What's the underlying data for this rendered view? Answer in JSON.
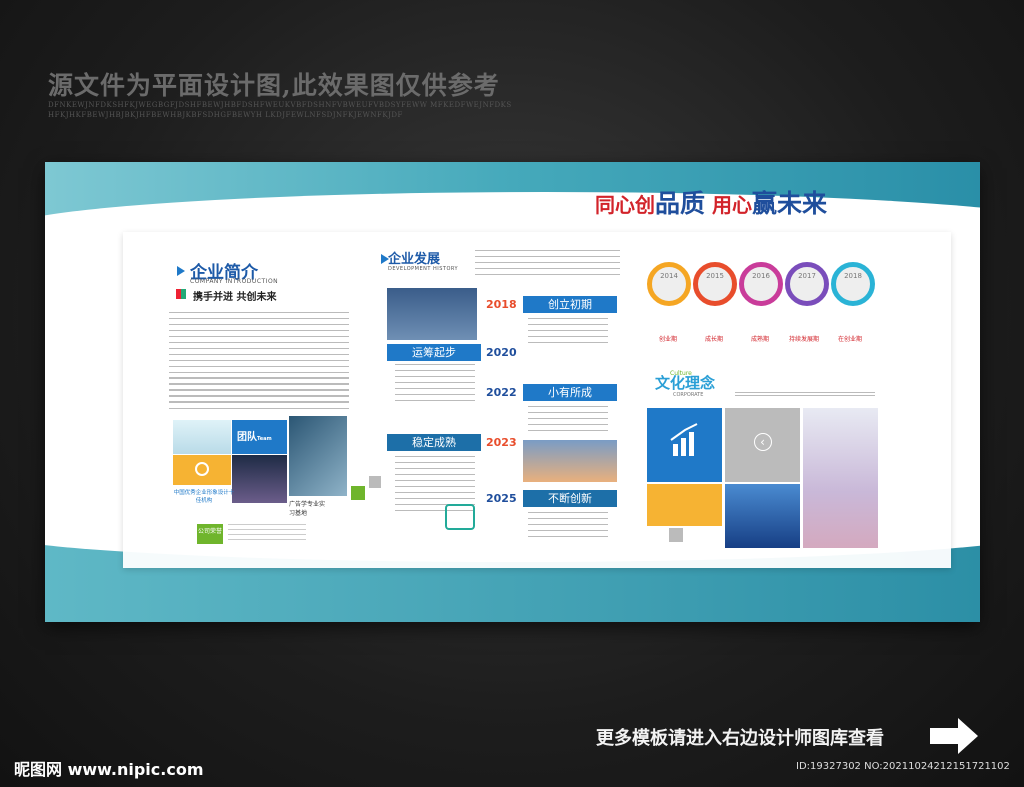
{
  "header": {
    "watermark_title": "源文件为平面设计图,此效果图仅供参考",
    "letters": "DFNKEWJNFDKSHFKJWEGBGFJDSHFBEWJHBFDSHFWEUKVBFDSHNFVBWEUFVBDSYFEWW MFKEDFWEJNFDKSHFKJHKFBEWJHBJBKJHFBEWHBJKBFSDHGFBEWYH LKDJFEWLNFSDJNFKJEWNFKJDF"
  },
  "board": {
    "slogan": {
      "part1": "同心创",
      "part2": "品质",
      "part3": " 用心",
      "part4": "赢未来"
    },
    "intro": {
      "title": "企业简介",
      "subtitle": "COMPANY INTRODUCTION",
      "tagline": "携手并进 共创未来",
      "tiles": {
        "team": "团队",
        "team_en": "Team",
        "honor_title": "中国优秀企业形象设计十佳机构",
        "company_honor": "公司荣誉",
        "ad_label": "广告学专业实习基地"
      }
    },
    "development": {
      "title": "企业发展",
      "subtitle": "DEVELOPMENT HISTORY",
      "milestones": [
        {
          "year": "2018",
          "label": "创立初期"
        },
        {
          "year": "2020",
          "label": "运筹起步"
        },
        {
          "year": "2022",
          "label": "小有所成"
        },
        {
          "year": "2023",
          "label": "稳定成熟"
        },
        {
          "year": "2025",
          "label": "不断创新"
        }
      ]
    },
    "timeline_circles": [
      {
        "year": "2014",
        "stage": "创业期"
      },
      {
        "year": "2015",
        "stage": "成长期"
      },
      {
        "year": "2016",
        "stage": "成熟期"
      },
      {
        "year": "2017",
        "stage": "持续发展期"
      },
      {
        "year": "2018",
        "stage": "在创业期"
      }
    ],
    "culture": {
      "title": "文化理念",
      "en1": "Culture",
      "en2": "CORPORATE"
    }
  },
  "footer": {
    "cta": "更多模板请进入右边设计师图库查看",
    "logo": "昵图网 www.nipic.com",
    "id": "ID:19327302 NO:20211024212151721102"
  },
  "colors": {
    "accent_blue": "#1f79c8",
    "accent_red": "#d2232a",
    "teal": "#45a9bb"
  }
}
